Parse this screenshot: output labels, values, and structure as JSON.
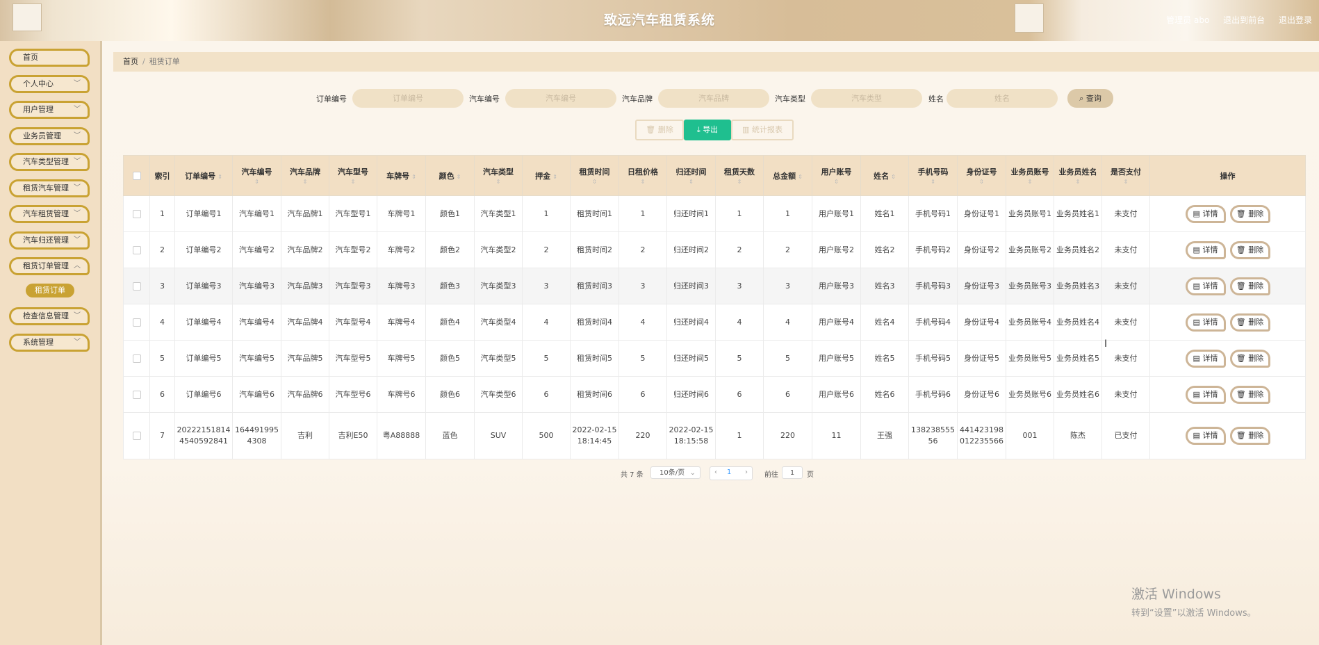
{
  "header": {
    "title": "致远汽车租赁系统",
    "admin_label": "管理员 abo",
    "back_to_front": "退出到前台",
    "logout": "退出登录"
  },
  "sidebar": {
    "items": [
      {
        "label": "首页",
        "has_chevron": false
      },
      {
        "label": "个人中心",
        "has_chevron": true
      },
      {
        "label": "用户管理",
        "has_chevron": true
      },
      {
        "label": "业务员管理",
        "has_chevron": true
      },
      {
        "label": "汽车类型管理",
        "has_chevron": true
      },
      {
        "label": "租赁汽车管理",
        "has_chevron": true
      },
      {
        "label": "汽车租赁管理",
        "has_chevron": true
      },
      {
        "label": "汽车归还管理",
        "has_chevron": true
      },
      {
        "label": "租赁订单管理",
        "has_chevron": true
      },
      {
        "label": "检查信息管理",
        "has_chevron": true
      },
      {
        "label": "系统管理",
        "has_chevron": true
      }
    ],
    "active_subitem": "租赁订单"
  },
  "breadcrumb": {
    "home": "首页",
    "separator": "/",
    "current": "租赁订单"
  },
  "search": {
    "fields": [
      {
        "label": "订单编号",
        "placeholder": "订单编号"
      },
      {
        "label": "汽车编号",
        "placeholder": "汽车编号"
      },
      {
        "label": "汽车品牌",
        "placeholder": "汽车品牌"
      },
      {
        "label": "汽车类型",
        "placeholder": "汽车类型"
      },
      {
        "label": "姓名",
        "placeholder": "姓名"
      }
    ],
    "query_button": "查询"
  },
  "toolbar": {
    "delete": "删除",
    "export": "导出",
    "stats": "统计报表"
  },
  "table": {
    "columns": [
      "索引",
      "订单编号",
      "汽车编号",
      "汽车品牌",
      "汽车型号",
      "车牌号",
      "颜色",
      "汽车类型",
      "押金",
      "租赁时间",
      "日租价格",
      "归还时间",
      "租赁天数",
      "总金额",
      "用户账号",
      "姓名",
      "手机号码",
      "身份证号",
      "业务员账号",
      "业务员姓名",
      "是否支付",
      "操作"
    ],
    "rows": [
      [
        "1",
        "订单编号1",
        "汽车编号1",
        "汽车品牌1",
        "汽车型号1",
        "车牌号1",
        "颜色1",
        "汽车类型1",
        "1",
        "租赁时间1",
        "1",
        "归还时间1",
        "1",
        "1",
        "用户账号1",
        "姓名1",
        "手机号码1",
        "身份证号1",
        "业务员账号1",
        "业务员姓名1",
        "未支付"
      ],
      [
        "2",
        "订单编号2",
        "汽车编号2",
        "汽车品牌2",
        "汽车型号2",
        "车牌号2",
        "颜色2",
        "汽车类型2",
        "2",
        "租赁时间2",
        "2",
        "归还时间2",
        "2",
        "2",
        "用户账号2",
        "姓名2",
        "手机号码2",
        "身份证号2",
        "业务员账号2",
        "业务员姓名2",
        "未支付"
      ],
      [
        "3",
        "订单编号3",
        "汽车编号3",
        "汽车品牌3",
        "汽车型号3",
        "车牌号3",
        "颜色3",
        "汽车类型3",
        "3",
        "租赁时间3",
        "3",
        "归还时间3",
        "3",
        "3",
        "用户账号3",
        "姓名3",
        "手机号码3",
        "身份证号3",
        "业务员账号3",
        "业务员姓名3",
        "未支付"
      ],
      [
        "4",
        "订单编号4",
        "汽车编号4",
        "汽车品牌4",
        "汽车型号4",
        "车牌号4",
        "颜色4",
        "汽车类型4",
        "4",
        "租赁时间4",
        "4",
        "归还时间4",
        "4",
        "4",
        "用户账号4",
        "姓名4",
        "手机号码4",
        "身份证号4",
        "业务员账号4",
        "业务员姓名4",
        "未支付"
      ],
      [
        "5",
        "订单编号5",
        "汽车编号5",
        "汽车品牌5",
        "汽车型号5",
        "车牌号5",
        "颜色5",
        "汽车类型5",
        "5",
        "租赁时间5",
        "5",
        "归还时间5",
        "5",
        "5",
        "用户账号5",
        "姓名5",
        "手机号码5",
        "身份证号5",
        "业务员账号5",
        "业务员姓名5",
        "未支付"
      ],
      [
        "6",
        "订单编号6",
        "汽车编号6",
        "汽车品牌6",
        "汽车型号6",
        "车牌号6",
        "颜色6",
        "汽车类型6",
        "6",
        "租赁时间6",
        "6",
        "归还时间6",
        "6",
        "6",
        "用户账号6",
        "姓名6",
        "手机号码6",
        "身份证号6",
        "业务员账号6",
        "业务员姓名6",
        "未支付"
      ],
      [
        "7",
        "202221518144540592841",
        "1644919954308",
        "吉利",
        "吉利E50",
        "粤A88888",
        "蓝色",
        "SUV",
        "500",
        "2022-02-15 18:14:45",
        "220",
        "2022-02-15 18:15:58",
        "1",
        "220",
        "11",
        "王强",
        "13823855556",
        "441423198012235566",
        "001",
        "陈杰",
        "已支付"
      ]
    ],
    "action_detail": "详情",
    "action_delete": "删除"
  },
  "pagination": {
    "total_text": "共 7 条",
    "page_size": "10条/页",
    "current_page": "1",
    "goto_label": "前往",
    "goto_value": "1",
    "page_unit": "页"
  },
  "watermark": {
    "line1": "激活 Windows",
    "line2": "转到“设置”以激活 Windows。"
  },
  "colors": {
    "accent": "#c9a233",
    "export_green": "#1fbf8f",
    "header_bg": "#d7bd98",
    "sidebar_bg": "#f2dfc4"
  }
}
